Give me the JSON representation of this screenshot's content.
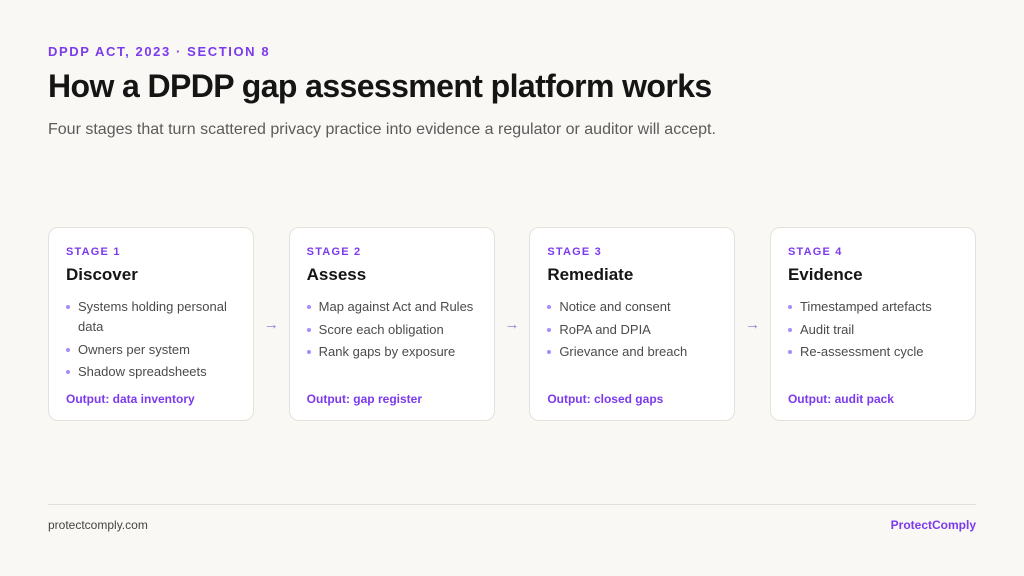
{
  "eyebrow": "DPDP ACT, 2023 · SECTION 8",
  "title": "How a DPDP gap assessment platform works",
  "subtitle": "Four stages that turn scattered privacy practice into evidence a regulator or auditor will accept.",
  "arrow_glyph": "→",
  "stages": [
    {
      "label": "STAGE 1",
      "name": "Discover",
      "items": [
        "Systems holding personal data",
        "Owners per system",
        "Shadow spreadsheets"
      ],
      "output": "Output: data inventory"
    },
    {
      "label": "STAGE 2",
      "name": "Assess",
      "items": [
        "Map against Act and Rules",
        "Score each obligation",
        "Rank gaps by exposure"
      ],
      "output": "Output: gap register"
    },
    {
      "label": "STAGE 3",
      "name": "Remediate",
      "items": [
        "Notice and consent",
        "RoPA and DPIA",
        "Grievance and breach"
      ],
      "output": "Output: closed gaps"
    },
    {
      "label": "STAGE 4",
      "name": "Evidence",
      "items": [
        "Timestamped artefacts",
        "Audit trail",
        "Re-assessment cycle"
      ],
      "output": "Output: audit pack"
    }
  ],
  "footer": {
    "url": "protectcomply.com",
    "brand": "ProtectComply"
  },
  "colors": {
    "accent": "#7c3aed",
    "background": "#f9f8f4",
    "card": "#ffffff"
  }
}
